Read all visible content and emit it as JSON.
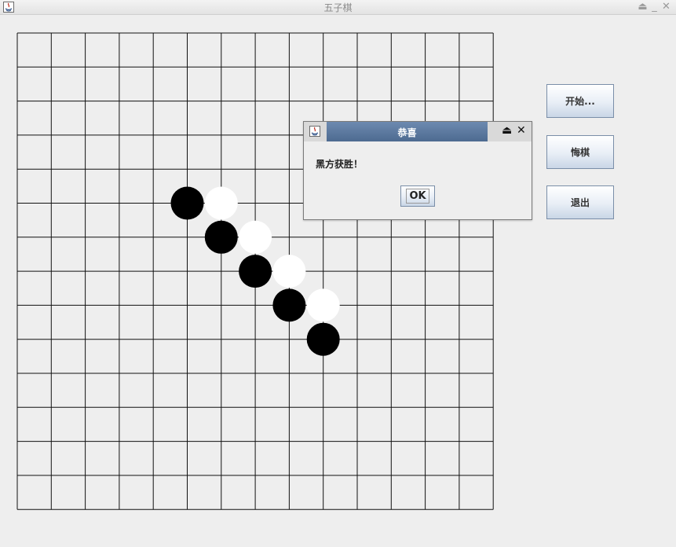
{
  "window": {
    "title": "五子棋",
    "controls": [
      "⏏",
      "_",
      "✕"
    ]
  },
  "board": {
    "grid_lines": 15,
    "stones": [
      {
        "color": "black",
        "row": 5,
        "col": 5
      },
      {
        "color": "white",
        "row": 5,
        "col": 6
      },
      {
        "color": "black",
        "row": 6,
        "col": 6
      },
      {
        "color": "white",
        "row": 6,
        "col": 7
      },
      {
        "color": "black",
        "row": 7,
        "col": 7
      },
      {
        "color": "white",
        "row": 7,
        "col": 8
      },
      {
        "color": "black",
        "row": 8,
        "col": 8
      },
      {
        "color": "white",
        "row": 8,
        "col": 9
      },
      {
        "color": "black",
        "row": 9,
        "col": 9
      }
    ]
  },
  "buttons": {
    "start": "开始...",
    "undo": "悔棋",
    "exit": "退出"
  },
  "dialog": {
    "title": "恭喜",
    "message": "黑方获胜！",
    "ok": "OK",
    "min_icon": "⏏",
    "close_icon": "✕"
  }
}
